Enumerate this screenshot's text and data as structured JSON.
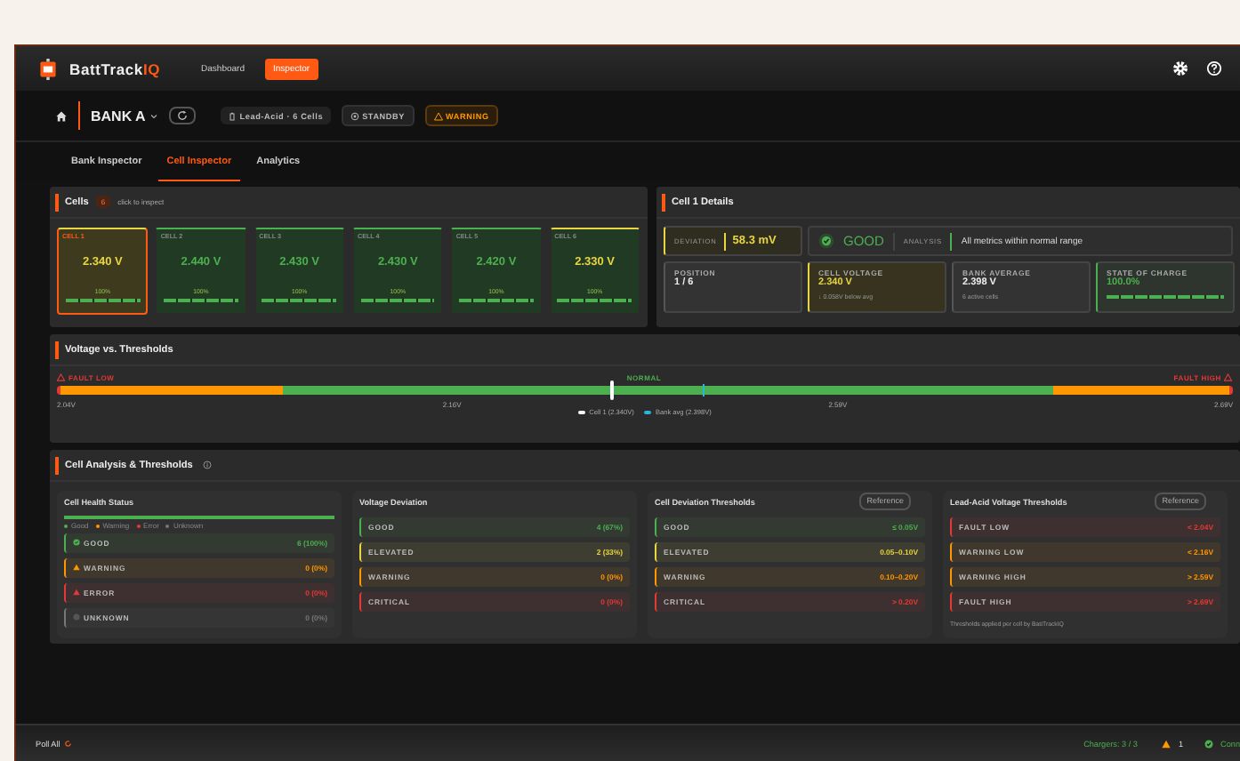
{
  "app": {
    "name": "BattTrack",
    "name_accent": "IQ"
  },
  "nav": [
    {
      "label": "Dashboard",
      "selected": false
    },
    {
      "label": "Inspector",
      "selected": true
    }
  ],
  "bank": {
    "name": "BANK A",
    "chips": [
      {
        "kind": "info",
        "label": "Lead-Acid · 6 Cells"
      },
      {
        "kind": "status",
        "label": "STANDBY"
      },
      {
        "kind": "warning",
        "label": "WARNING"
      }
    ]
  },
  "tabs": [
    {
      "label": "Bank Inspector",
      "selected": false
    },
    {
      "label": "Cell Inspector",
      "selected": true
    },
    {
      "label": "Analytics",
      "selected": false
    }
  ],
  "cells_panel": {
    "title": "Cells",
    "count": "6",
    "hint": "click to inspect",
    "cells": [
      {
        "label": "CELL 1",
        "voltage": "2.340 V",
        "soc": "100%",
        "level": 1,
        "color": "#e8d640",
        "selected": true
      },
      {
        "label": "CELL 2",
        "voltage": "2.440 V",
        "soc": "100%",
        "level": 1,
        "color": "#4caf50",
        "selected": false
      },
      {
        "label": "CELL 3",
        "voltage": "2.430 V",
        "soc": "100%",
        "level": 1,
        "color": "#4caf50",
        "selected": false
      },
      {
        "label": "CELL 4",
        "voltage": "2.430 V",
        "soc": "100%",
        "level": 1,
        "color": "#4caf50",
        "selected": false
      },
      {
        "label": "CELL 5",
        "voltage": "2.420 V",
        "soc": "100%",
        "level": 1,
        "color": "#4caf50",
        "selected": false
      },
      {
        "label": "CELL 6",
        "voltage": "2.330 V",
        "soc": "100%",
        "level": 1,
        "color": "#e8d640",
        "selected": false
      }
    ]
  },
  "details": {
    "title": "Cell 1 Details",
    "deviation_label": "DEVIATION",
    "deviation": "58.3 mV",
    "status": "GOOD",
    "analysis_label": "ANALYSIS",
    "analysis": "All metrics within normal range",
    "stats": [
      {
        "kind": "plain",
        "label": "POSITION",
        "value": "1 / 6"
      },
      {
        "kind": "warn",
        "label": "CELL VOLTAGE",
        "value": "2.340 V",
        "note": "↓ 0.058V below avg"
      },
      {
        "kind": "plain",
        "label": "BANK AVERAGE",
        "value": "2.398 V",
        "note": "6 active cells"
      },
      {
        "kind": "good",
        "label": "STATE OF CHARGE",
        "value": "100.0%",
        "level": 1
      }
    ]
  },
  "voltage": {
    "title": "Voltage vs. Thresholds",
    "zone_left": "FAULT LOW",
    "zone_center": "NORMAL",
    "zone_right": "FAULT HIGH",
    "segments": [
      {
        "kind": "warning",
        "level": 0.19
      },
      {
        "kind": "good",
        "level": 0.85
      },
      {
        "kind": "warning",
        "level": 1
      }
    ],
    "markers": [
      {
        "label": "Cell 1 (2.340V)",
        "level": 0.47,
        "color": "#ffffff"
      },
      {
        "label": "Bank avg (2.398V)",
        "level": 0.55,
        "color": "#29b6d8"
      }
    ],
    "ticks": [
      "2.04V",
      "2.16V",
      "2.59V",
      "2.69V"
    ]
  },
  "analysis": {
    "title": "Cell Analysis & Thresholds",
    "health": {
      "title": "Cell Health Status",
      "level": 1,
      "legend": [
        {
          "label": "Good",
          "color": "#4caf50"
        },
        {
          "label": "Warning",
          "color": "#ff9800"
        },
        {
          "label": "Error",
          "color": "#e53935"
        },
        {
          "label": "Unknown",
          "color": "#777777"
        }
      ],
      "rows": [
        {
          "kind": "good",
          "label": "GOOD",
          "value": "6 (100%)"
        },
        {
          "kind": "warning",
          "label": "WARNING",
          "value": "0 (0%)"
        },
        {
          "kind": "error",
          "label": "ERROR",
          "value": "0 (0%)"
        },
        {
          "kind": "unknown",
          "label": "UNKNOWN",
          "value": "0 (0%)"
        }
      ]
    },
    "deviation": {
      "title": "Voltage Deviation",
      "rows": [
        {
          "kind": "good",
          "label": "GOOD",
          "value": "4 (67%)"
        },
        {
          "kind": "elevated",
          "label": "ELEVATED",
          "value": "2 (33%)"
        },
        {
          "kind": "warning",
          "label": "WARNING",
          "value": "0 (0%)"
        },
        {
          "kind": "error",
          "label": "CRITICAL",
          "value": "0 (0%)"
        }
      ]
    },
    "thresholds": [
      {
        "title": "Cell Deviation Thresholds",
        "badge": "Reference",
        "rows": [
          {
            "kind": "good",
            "label": "GOOD",
            "value": "≤ 0.05V"
          },
          {
            "kind": "elevated",
            "label": "ELEVATED",
            "value": "0.05–0.10V"
          },
          {
            "kind": "warning",
            "label": "WARNING",
            "value": "0.10–0.20V"
          },
          {
            "kind": "error",
            "label": "CRITICAL",
            "value": "> 0.20V"
          }
        ]
      },
      {
        "title": "Lead-Acid Voltage Thresholds",
        "badge": "Reference",
        "rows": [
          {
            "kind": "error",
            "label": "FAULT LOW",
            "value": "< 2.04V"
          },
          {
            "kind": "warning",
            "label": "WARNING LOW",
            "value": "< 2.16V"
          },
          {
            "kind": "warning",
            "label": "WARNING HIGH",
            "value": "> 2.59V"
          },
          {
            "kind": "error",
            "label": "FAULT HIGH",
            "value": "> 2.69V"
          }
        ],
        "note": "Thresholds applied per cell by BattTrackIQ"
      }
    ]
  },
  "status_bar": {
    "poll": "Poll All",
    "chargers": "Chargers: 3 / 3",
    "alerts": "1",
    "connection": "Conn"
  }
}
